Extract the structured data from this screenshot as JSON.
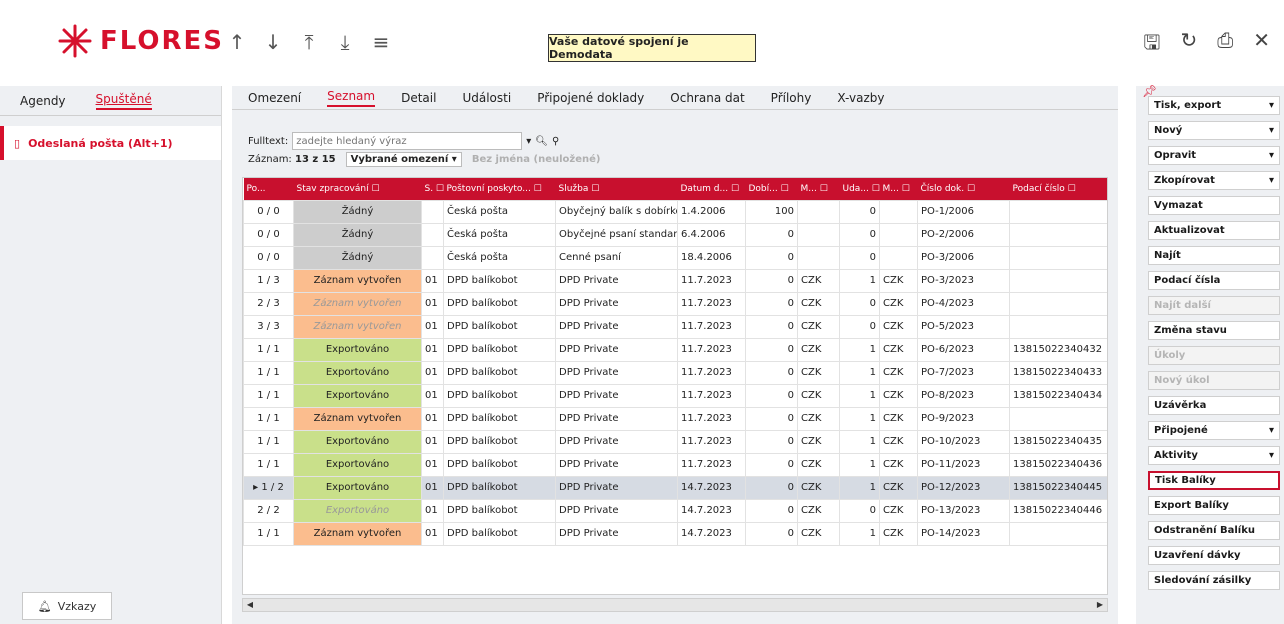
{
  "header": {
    "logo_text": "FLORES",
    "notice": "Vaše datové spojení je Demodata",
    "nav_icons": [
      "arrow-up-icon",
      "arrow-down-icon",
      "arrow-top-icon",
      "arrow-bottom-icon",
      "menu-icon"
    ],
    "right_icons": [
      "save-icon",
      "refresh-icon",
      "print-icon",
      "close-icon"
    ]
  },
  "left": {
    "tabs": [
      "Agendy",
      "Spuštěné"
    ],
    "item_label": "Odeslaná pošta (Alt+1)",
    "vzkazy_label": "Vzkazy"
  },
  "main": {
    "tabs": [
      "Omezení",
      "Seznam",
      "Detail",
      "Události",
      "Připojené doklady",
      "Ochrana dat",
      "Přílohy",
      "X-vazby"
    ],
    "fulltext_label": "Fulltext:",
    "fulltext_placeholder": "zadejte hledaný výraz",
    "record_label": "Záznam:",
    "record_value": "13 z 15",
    "omezeni_value": "Vybrané omezení",
    "noname": "Bez jména (neuložené)",
    "columns": [
      "Po...",
      "Stav zpracování ☐",
      "S. ☐",
      "Poštovní poskyto... ☐",
      "Služba ☐",
      "Datum d... ☐",
      "Dobí... ☐",
      "M... ☐",
      "Uda... ☐",
      "M... ☐",
      "Číslo dok. ☐",
      "Podací číslo ☐"
    ],
    "rows": [
      {
        "po": "0 / 0",
        "stav": "Žádný",
        "state": "none",
        "s": "",
        "postovni": "Česká pošta",
        "sluzba": "Obyčejný balík s dobírkou",
        "datum": "1.4.2006",
        "dobi": "100",
        "m1": "",
        "uda": "0",
        "m2": "",
        "cislo": "PO-1/2006",
        "podaci": ""
      },
      {
        "po": "0 / 0",
        "stav": "Žádný",
        "state": "none",
        "s": "",
        "postovni": "Česká pošta",
        "sluzba": "Obyčejné psaní standard p",
        "datum": "6.4.2006",
        "dobi": "0",
        "m1": "",
        "uda": "0",
        "m2": "",
        "cislo": "PO-2/2006",
        "podaci": ""
      },
      {
        "po": "0 / 0",
        "stav": "Žádný",
        "state": "none",
        "s": "",
        "postovni": "Česká pošta",
        "sluzba": "Cenné psaní",
        "datum": "18.4.2006",
        "dobi": "0",
        "m1": "",
        "uda": "0",
        "m2": "",
        "cislo": "PO-3/2006",
        "podaci": ""
      },
      {
        "po": "1 / 3",
        "stav": "Záznam vytvořen",
        "state": "created",
        "s": "01",
        "postovni": "DPD balíkobot",
        "sluzba": "DPD Private",
        "datum": "11.7.2023",
        "dobi": "0",
        "m1": "CZK",
        "uda": "1",
        "m2": "CZK",
        "cislo": "PO-3/2023",
        "podaci": ""
      },
      {
        "po": "2 / 3",
        "stav": "Záznam vytvořen",
        "state": "created-faded",
        "s": "01",
        "postovni": "DPD balíkobot",
        "sluzba": "DPD Private",
        "datum": "11.7.2023",
        "dobi": "0",
        "m1": "CZK",
        "uda": "0",
        "m2": "CZK",
        "cislo": "PO-4/2023",
        "podaci": ""
      },
      {
        "po": "3 / 3",
        "stav": "Záznam vytvořen",
        "state": "created-faded",
        "s": "01",
        "postovni": "DPD balíkobot",
        "sluzba": "DPD Private",
        "datum": "11.7.2023",
        "dobi": "0",
        "m1": "CZK",
        "uda": "0",
        "m2": "CZK",
        "cislo": "PO-5/2023",
        "podaci": ""
      },
      {
        "po": "1 / 1",
        "stav": "Exportováno",
        "state": "export",
        "s": "01",
        "postovni": "DPD balíkobot",
        "sluzba": "DPD Private",
        "datum": "11.7.2023",
        "dobi": "0",
        "m1": "CZK",
        "uda": "1",
        "m2": "CZK",
        "cislo": "PO-6/2023",
        "podaci": "13815022340432"
      },
      {
        "po": "1 / 1",
        "stav": "Exportováno",
        "state": "export",
        "s": "01",
        "postovni": "DPD balíkobot",
        "sluzba": "DPD Private",
        "datum": "11.7.2023",
        "dobi": "0",
        "m1": "CZK",
        "uda": "1",
        "m2": "CZK",
        "cislo": "PO-7/2023",
        "podaci": "13815022340433"
      },
      {
        "po": "1 / 1",
        "stav": "Exportováno",
        "state": "export",
        "s": "01",
        "postovni": "DPD balíkobot",
        "sluzba": "DPD Private",
        "datum": "11.7.2023",
        "dobi": "0",
        "m1": "CZK",
        "uda": "1",
        "m2": "CZK",
        "cislo": "PO-8/2023",
        "podaci": "13815022340434"
      },
      {
        "po": "1 / 1",
        "stav": "Záznam vytvořen",
        "state": "created",
        "s": "01",
        "postovni": "DPD balíkobot",
        "sluzba": "DPD Private",
        "datum": "11.7.2023",
        "dobi": "0",
        "m1": "CZK",
        "uda": "1",
        "m2": "CZK",
        "cislo": "PO-9/2023",
        "podaci": ""
      },
      {
        "po": "1 / 1",
        "stav": "Exportováno",
        "state": "export",
        "s": "01",
        "postovni": "DPD balíkobot",
        "sluzba": "DPD Private",
        "datum": "11.7.2023",
        "dobi": "0",
        "m1": "CZK",
        "uda": "1",
        "m2": "CZK",
        "cislo": "PO-10/2023",
        "podaci": "13815022340435"
      },
      {
        "po": "1 / 1",
        "stav": "Exportováno",
        "state": "export",
        "s": "01",
        "postovni": "DPD balíkobot",
        "sluzba": "DPD Private",
        "datum": "11.7.2023",
        "dobi": "0",
        "m1": "CZK",
        "uda": "1",
        "m2": "CZK",
        "cislo": "PO-11/2023",
        "podaci": "13815022340436"
      },
      {
        "po": "1 / 2",
        "stav": "Exportováno",
        "state": "export",
        "selected": true,
        "s": "01",
        "postovni": "DPD balíkobot",
        "sluzba": "DPD Private",
        "datum": "14.7.2023",
        "dobi": "0",
        "m1": "CZK",
        "uda": "1",
        "m2": "CZK",
        "cislo": "PO-12/2023",
        "podaci": "13815022340445"
      },
      {
        "po": "2 / 2",
        "stav": "Exportováno",
        "state": "export-faded",
        "s": "01",
        "postovni": "DPD balíkobot",
        "sluzba": "DPD Private",
        "datum": "14.7.2023",
        "dobi": "0",
        "m1": "CZK",
        "uda": "0",
        "m2": "CZK",
        "cislo": "PO-13/2023",
        "podaci": "13815022340446"
      },
      {
        "po": "1 / 1",
        "stav": "Záznam vytvořen",
        "state": "created",
        "s": "01",
        "postovni": "DPD balíkobot",
        "sluzba": "DPD Private",
        "datum": "14.7.2023",
        "dobi": "0",
        "m1": "CZK",
        "uda": "1",
        "m2": "CZK",
        "cislo": "PO-14/2023",
        "podaci": ""
      }
    ]
  },
  "actions": [
    {
      "label": "Tisk, export",
      "dropdown": true
    },
    {
      "label": "Nový",
      "dropdown": true
    },
    {
      "label": "Opravit",
      "dropdown": true
    },
    {
      "label": "Zkopírovat",
      "dropdown": true
    },
    {
      "label": "Vymazat"
    },
    {
      "label": "Aktualizovat"
    },
    {
      "label": "Najít"
    },
    {
      "label": "Podací čísla"
    },
    {
      "label": "Najít další",
      "disabled": true
    },
    {
      "label": "Změna stavu"
    },
    {
      "label": "Úkoly",
      "disabled": true
    },
    {
      "label": "Nový úkol",
      "disabled": true
    },
    {
      "label": "Uzávěrka"
    },
    {
      "label": "Připojené",
      "dropdown": true
    },
    {
      "label": "Aktivity",
      "dropdown": true
    },
    {
      "label": "Tisk Balíky",
      "highlight": true
    },
    {
      "label": "Export Balíky"
    },
    {
      "label": "Odstranění Balíku"
    },
    {
      "label": "Uzavření dávky"
    },
    {
      "label": "Sledování zásilky"
    }
  ]
}
